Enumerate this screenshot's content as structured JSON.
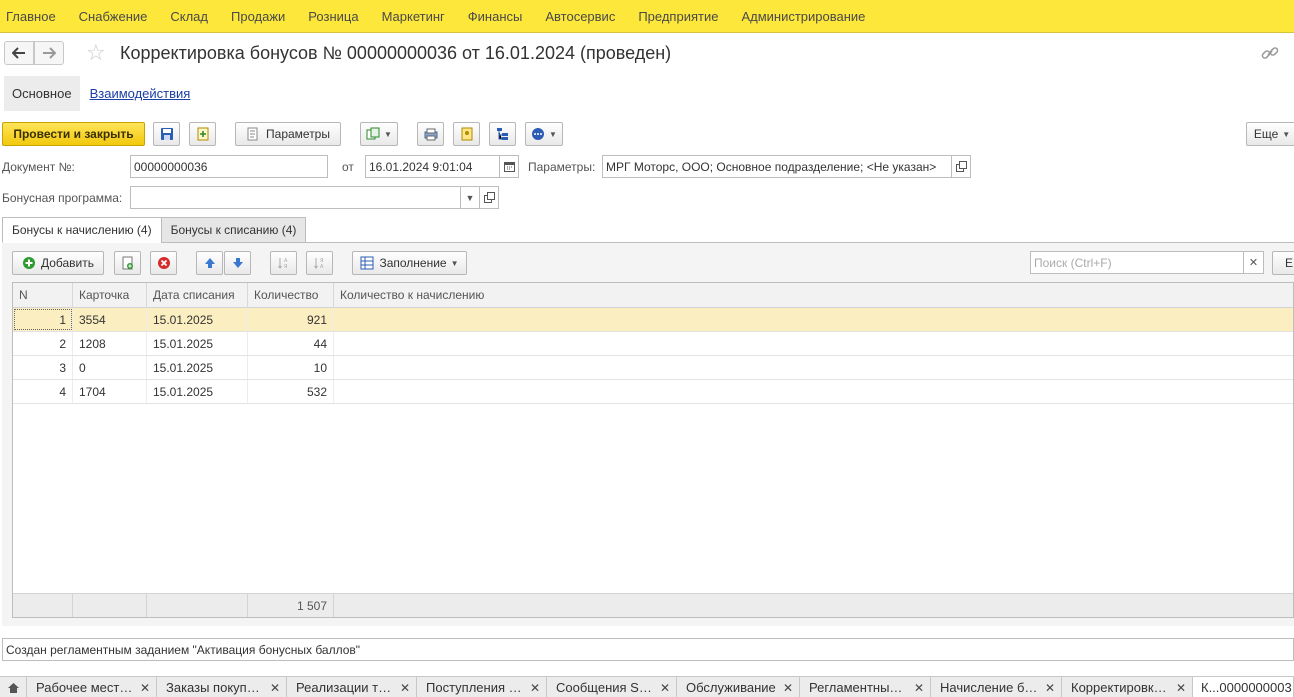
{
  "top_menu": [
    "Главное",
    "Снабжение",
    "Склад",
    "Продажи",
    "Розница",
    "Маркетинг",
    "Финансы",
    "Автосервис",
    "Предприятие",
    "Администрирование"
  ],
  "title": "Корректировка бонусов № 00000000036 от 16.01.2024 (проведен)",
  "sections": {
    "main": "Основное",
    "link": "Взаимодействия"
  },
  "toolbar": {
    "post_close": "Провести и закрыть",
    "params": "Параметры",
    "more": "Еще"
  },
  "form": {
    "doc_no_label": "Документ №:",
    "doc_no": "00000000036",
    "from_label": "от",
    "date": "16.01.2024  9:01:04",
    "params_label": "Параметры:",
    "params_value": "МРГ Моторс, ООО; Основное подразделение; <Не указан>",
    "program_label": "Бонусная программа:",
    "program_value": ""
  },
  "tabs": {
    "accrual": "Бонусы к начислению (4)",
    "writeoff": "Бонусы к списанию (4)"
  },
  "table_toolbar": {
    "add": "Добавить",
    "fill": "Заполнение",
    "search_placeholder": "Поиск (Ctrl+F)",
    "cut_label": "Е"
  },
  "table": {
    "columns": [
      "N",
      "Карточка",
      "Дата списания",
      "Количество",
      "Количество к начислению"
    ],
    "rows": [
      {
        "n": "1",
        "card": "3554",
        "date": "15.01.2025",
        "qty": "921",
        "accrue": ""
      },
      {
        "n": "2",
        "card": "1208",
        "date": "15.01.2025",
        "qty": "44",
        "accrue": ""
      },
      {
        "n": "3",
        "card": "0",
        "date": "15.01.2025",
        "qty": "10",
        "accrue": ""
      },
      {
        "n": "4",
        "card": "1704",
        "date": "15.01.2025",
        "qty": "532",
        "accrue": ""
      }
    ],
    "total_qty": "1 507"
  },
  "comment": "Создан регламентным заданием \"Активация бонусных баллов\"",
  "window_tabs": [
    "Рабочее мест…",
    "Заказы покуп…",
    "Реализации т…",
    "Поступления …",
    "Сообщения S…",
    "Обслуживание",
    "Регламентны…",
    "Начисление б…",
    "Корректировк…",
    "К...0000000003"
  ],
  "colors": {
    "menu_bg": "#fde73a",
    "primary_btn": "#f2c90c",
    "selected_row": "#fbefc1",
    "link": "#1a3ea6"
  }
}
